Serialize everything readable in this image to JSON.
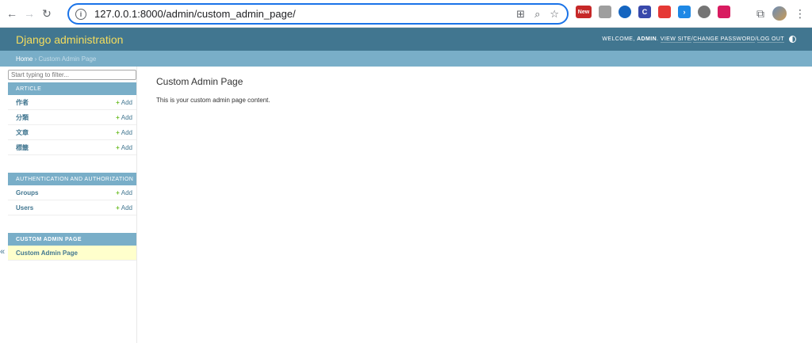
{
  "browser": {
    "url": "127.0.0.1:8000/admin/custom_admin_page/",
    "extensions": [
      {
        "name": "new-badge-extension",
        "label": "New",
        "color": "#c62828"
      },
      {
        "name": "ext-2",
        "label": "",
        "color": "#9e9e9e"
      },
      {
        "name": "ext-3",
        "label": "",
        "color": "#1565c0"
      },
      {
        "name": "ext-4",
        "label": "C",
        "color": "#3949ab"
      },
      {
        "name": "ext-5",
        "label": "",
        "color": "#e53935"
      },
      {
        "name": "ext-6",
        "label": "›",
        "color": "#1e88e5"
      },
      {
        "name": "ext-7",
        "label": "",
        "color": "#757575"
      },
      {
        "name": "ext-8",
        "label": "",
        "color": "#d81b60"
      }
    ]
  },
  "header": {
    "branding": "Django administration",
    "welcome": "Welcome,",
    "username": "admin",
    "view_site": "View site",
    "change_password": "Change password",
    "log_out": "Log out",
    "sep": " / "
  },
  "breadcrumbs": {
    "home": "Home",
    "sep": " › ",
    "current": "Custom Admin Page"
  },
  "sidebar": {
    "filter_placeholder": "Start typing to filter...",
    "modules": [
      {
        "caption": "Article",
        "models": [
          {
            "name": "作者",
            "add": "Add"
          },
          {
            "name": "分類",
            "add": "Add"
          },
          {
            "name": "文章",
            "add": "Add"
          },
          {
            "name": "標籤",
            "add": "Add"
          }
        ]
      },
      {
        "caption": "Authentication and Authorization",
        "models": [
          {
            "name": "Groups",
            "add": "Add"
          },
          {
            "name": "Users",
            "add": "Add"
          }
        ]
      },
      {
        "caption": "Custom Admin Page",
        "models": [
          {
            "name": "Custom Admin Page"
          }
        ]
      }
    ],
    "toggle": "«"
  },
  "content": {
    "title": "Custom Admin Page",
    "text": "This is your custom admin page content."
  }
}
